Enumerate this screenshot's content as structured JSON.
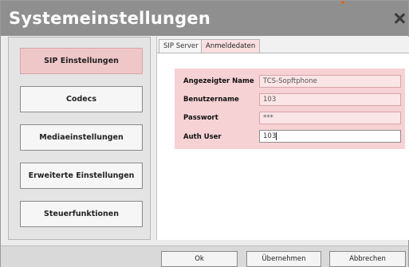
{
  "window": {
    "title": "Systemeinstellungen"
  },
  "sidebar": {
    "items": [
      {
        "label": "SIP Einstellungen"
      },
      {
        "label": "Codecs"
      },
      {
        "label": "Mediaeinstellungen"
      },
      {
        "label": "Erweiterte Einstellungen"
      },
      {
        "label": "Steuerfunktionen"
      }
    ]
  },
  "tabs": [
    {
      "label": "SIP Server"
    },
    {
      "label": "Anmeldedaten"
    }
  ],
  "form": {
    "fields": [
      {
        "label": "Angezeigter Name",
        "value": "TCS-Sopftphone"
      },
      {
        "label": "Benutzername",
        "value": "103"
      },
      {
        "label": "Passwort",
        "value": "***"
      },
      {
        "label": "Auth User",
        "value": "103"
      }
    ]
  },
  "buttons": {
    "ok": "Ok",
    "apply": "Übernehmen",
    "cancel": "Abbrechen"
  }
}
